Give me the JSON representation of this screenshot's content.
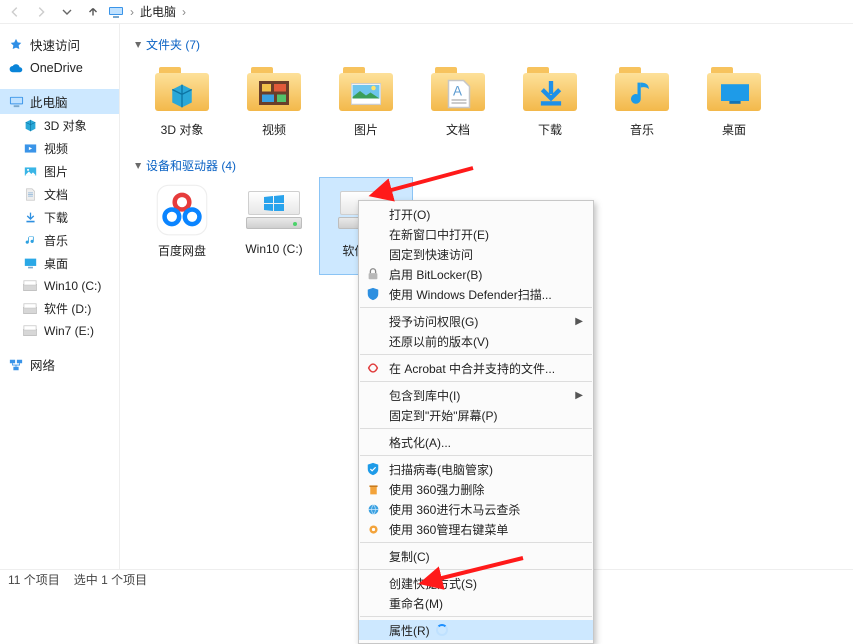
{
  "nav": {
    "breadcrumb_location": "此电脑"
  },
  "sidebar": {
    "quick": {
      "label": "快速访问"
    },
    "onedrive": {
      "label": "OneDrive"
    },
    "thispc": {
      "label": "此电脑"
    },
    "thispc_children": {
      "obj3d": {
        "label": "3D 对象"
      },
      "videos": {
        "label": "视频"
      },
      "pictures": {
        "label": "图片"
      },
      "docs": {
        "label": "文档"
      },
      "downloads": {
        "label": "下载"
      },
      "music": {
        "label": "音乐"
      },
      "desktop": {
        "label": "桌面"
      },
      "drive_c": {
        "label": "Win10 (C:)"
      },
      "drive_d": {
        "label": "软件 (D:)"
      },
      "drive_e": {
        "label": "Win7 (E:)"
      }
    },
    "network": {
      "label": "网络"
    }
  },
  "sections": {
    "folders": {
      "heading": "文件夹 (7)"
    },
    "drives": {
      "heading": "设备和驱动器 (4)"
    }
  },
  "tiles": {
    "obj3d": {
      "label": "3D 对象"
    },
    "videos": {
      "label": "视频"
    },
    "pictures": {
      "label": "图片"
    },
    "docs": {
      "label": "文档"
    },
    "downloads": {
      "label": "下载"
    },
    "music": {
      "label": "音乐"
    },
    "desktop": {
      "label": "桌面"
    },
    "baidu": {
      "label": "百度网盘"
    },
    "drive_c": {
      "label": "Win10 (C:)"
    },
    "drive_d": {
      "label": "软件 (D:)"
    }
  },
  "context_menu": {
    "open": "打开(O)",
    "open_new": "在新窗口中打开(E)",
    "pin_quick": "固定到快速访问",
    "bitlocker": "启用 BitLocker(B)",
    "defender": "使用 Windows Defender扫描...",
    "grant": "授予访问权限(G)",
    "restore": "还原以前的版本(V)",
    "acrobat": "在 Acrobat 中合并支持的文件...",
    "library": "包含到库中(I)",
    "pin_start": "固定到\"开始\"屏幕(P)",
    "format": "格式化(A)...",
    "qh_scan": "扫描病毒(电脑管家)",
    "qh_del": "使用 360强力删除",
    "qh_trojan": "使用 360进行木马云查杀",
    "qh_menu": "使用 360管理右键菜单",
    "copy": "复制(C)",
    "shortcut": "创建快捷方式(S)",
    "rename": "重命名(M)",
    "properties": "属性(R)"
  },
  "status": {
    "count": "11 个项目",
    "selection": "选中 1 个项目"
  }
}
